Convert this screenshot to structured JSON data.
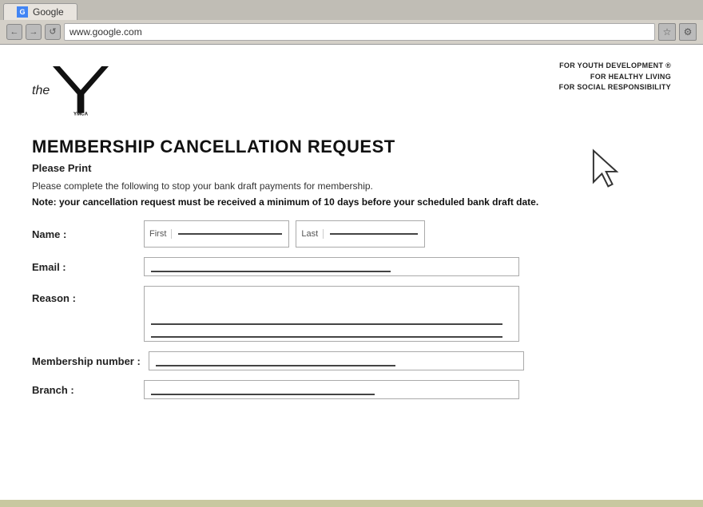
{
  "browser": {
    "tab_label": "Google",
    "address": "www.google.com",
    "nav_back": "←",
    "nav_forward": "→",
    "nav_refresh": "↺"
  },
  "header": {
    "logo_text": "the",
    "tagline_line1": "FOR YOUTH DEVELOPMENT ®",
    "tagline_line2": "FOR HEALTHY LIVING",
    "tagline_line3": "FOR SOCIAL RESPONSIBILITY"
  },
  "form": {
    "title": "MEMBERSHIP CANCELLATION REQUEST",
    "please_print": "Please Print",
    "instruction": "Please complete the following to stop your bank draft payments for membership.",
    "note": "Note: your cancellation request must be received a minimum of 10 days before your scheduled bank draft date.",
    "name_label": "Name :",
    "name_first_placeholder": "First",
    "name_last_placeholder": "Last",
    "email_label": "Email :",
    "reason_label": "Reason :",
    "membership_label": "Membership number :",
    "branch_label": "Branch :"
  }
}
